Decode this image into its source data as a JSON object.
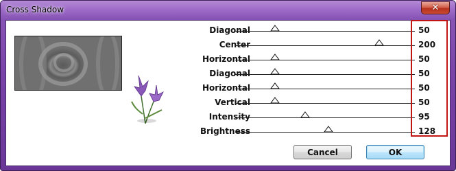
{
  "window": {
    "title": "Cross Shadow",
    "close_glyph": "✕"
  },
  "sliders": [
    {
      "label": "Diagonal",
      "value": "50",
      "position": 0.22
    },
    {
      "label": "Center",
      "value": "200",
      "position": 0.8
    },
    {
      "label": "Horizontal",
      "value": "50",
      "position": 0.22
    },
    {
      "label": "Diagonal",
      "value": "50",
      "position": 0.22
    },
    {
      "label": "Horizontal",
      "value": "50",
      "position": 0.22
    },
    {
      "label": "Vertical",
      "value": "50",
      "position": 0.22
    },
    {
      "label": "Intensity",
      "value": "95",
      "position": 0.39
    },
    {
      "label": "Brightness",
      "value": "128",
      "position": 0.52
    }
  ],
  "buttons": {
    "cancel": "Cancel",
    "ok": "OK"
  },
  "icons": {
    "close": "close-icon",
    "thumb": "triangle-thumb-icon",
    "flower": "flower-logo-icon"
  },
  "colors": {
    "highlight": "#c31414",
    "titlebar": "#9e6cc8"
  }
}
